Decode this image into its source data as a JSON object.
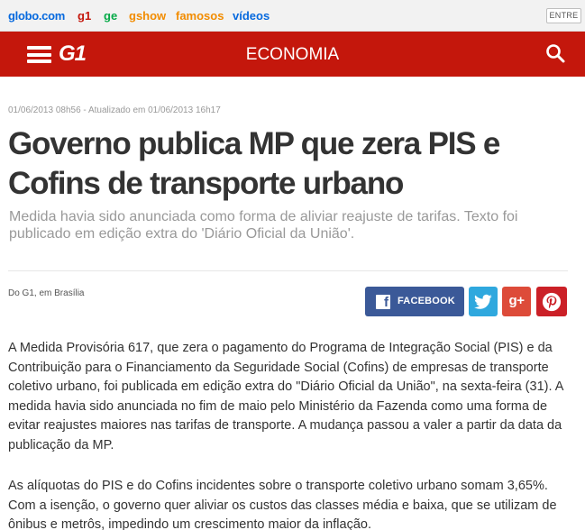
{
  "topbar": {
    "links": [
      "globo.com",
      "g1",
      "ge",
      "gshow",
      "famosos",
      "vídeos"
    ],
    "login_label": "ENTRE"
  },
  "header": {
    "logo": "G1",
    "section": "ECONOMIA"
  },
  "colors": {
    "brand_red": "#c4170c",
    "facebook": "#3b5998",
    "twitter": "#2fa8de",
    "googleplus": "#dd4b39",
    "pinterest": "#cb2027"
  },
  "article": {
    "timestamp": "01/06/2013 08h56 - Atualizado em 01/06/2013 16h17",
    "headline": "Governo publica MP que zera PIS e Cofins de transporte urbano",
    "subtitle": "Medida havia sido anunciada como forma de aliviar reajuste de tarifas. Texto foi publicado em edição extra do 'Diário Oficial da União'.",
    "byline": "Do G1, em Brasília",
    "paragraphs": [
      "A Medida Provisória 617, que zera o pagamento do Programa de Integração Social (PIS) e da Contribuição para o Financiamento da Seguridade Social (Cofins) de empresas de transporte coletivo urbano, foi publicada em edição extra do \"Diário Oficial da União\", na sexta-feira (31). A medida havia sido anunciada no fim de maio pelo Ministério da Fazenda como uma forma de evitar reajustes maiores nas tarifas de transporte. A mudança passou a valer a partir da data da publicação da MP.",
      "As alíquotas do PIS e do Cofins incidentes sobre o transporte coletivo urbano somam 3,65%. Com a isenção, o governo quer aliviar os custos das classes média e baixa, que se utilizam de ônibus e metrôs, impedindo um crescimento maior da inflação."
    ]
  },
  "share": {
    "facebook_label": "FACEBOOK",
    "googleplus_label": "g+",
    "icons": [
      "facebook-icon",
      "twitter-icon",
      "google-plus-icon",
      "pinterest-icon"
    ]
  }
}
